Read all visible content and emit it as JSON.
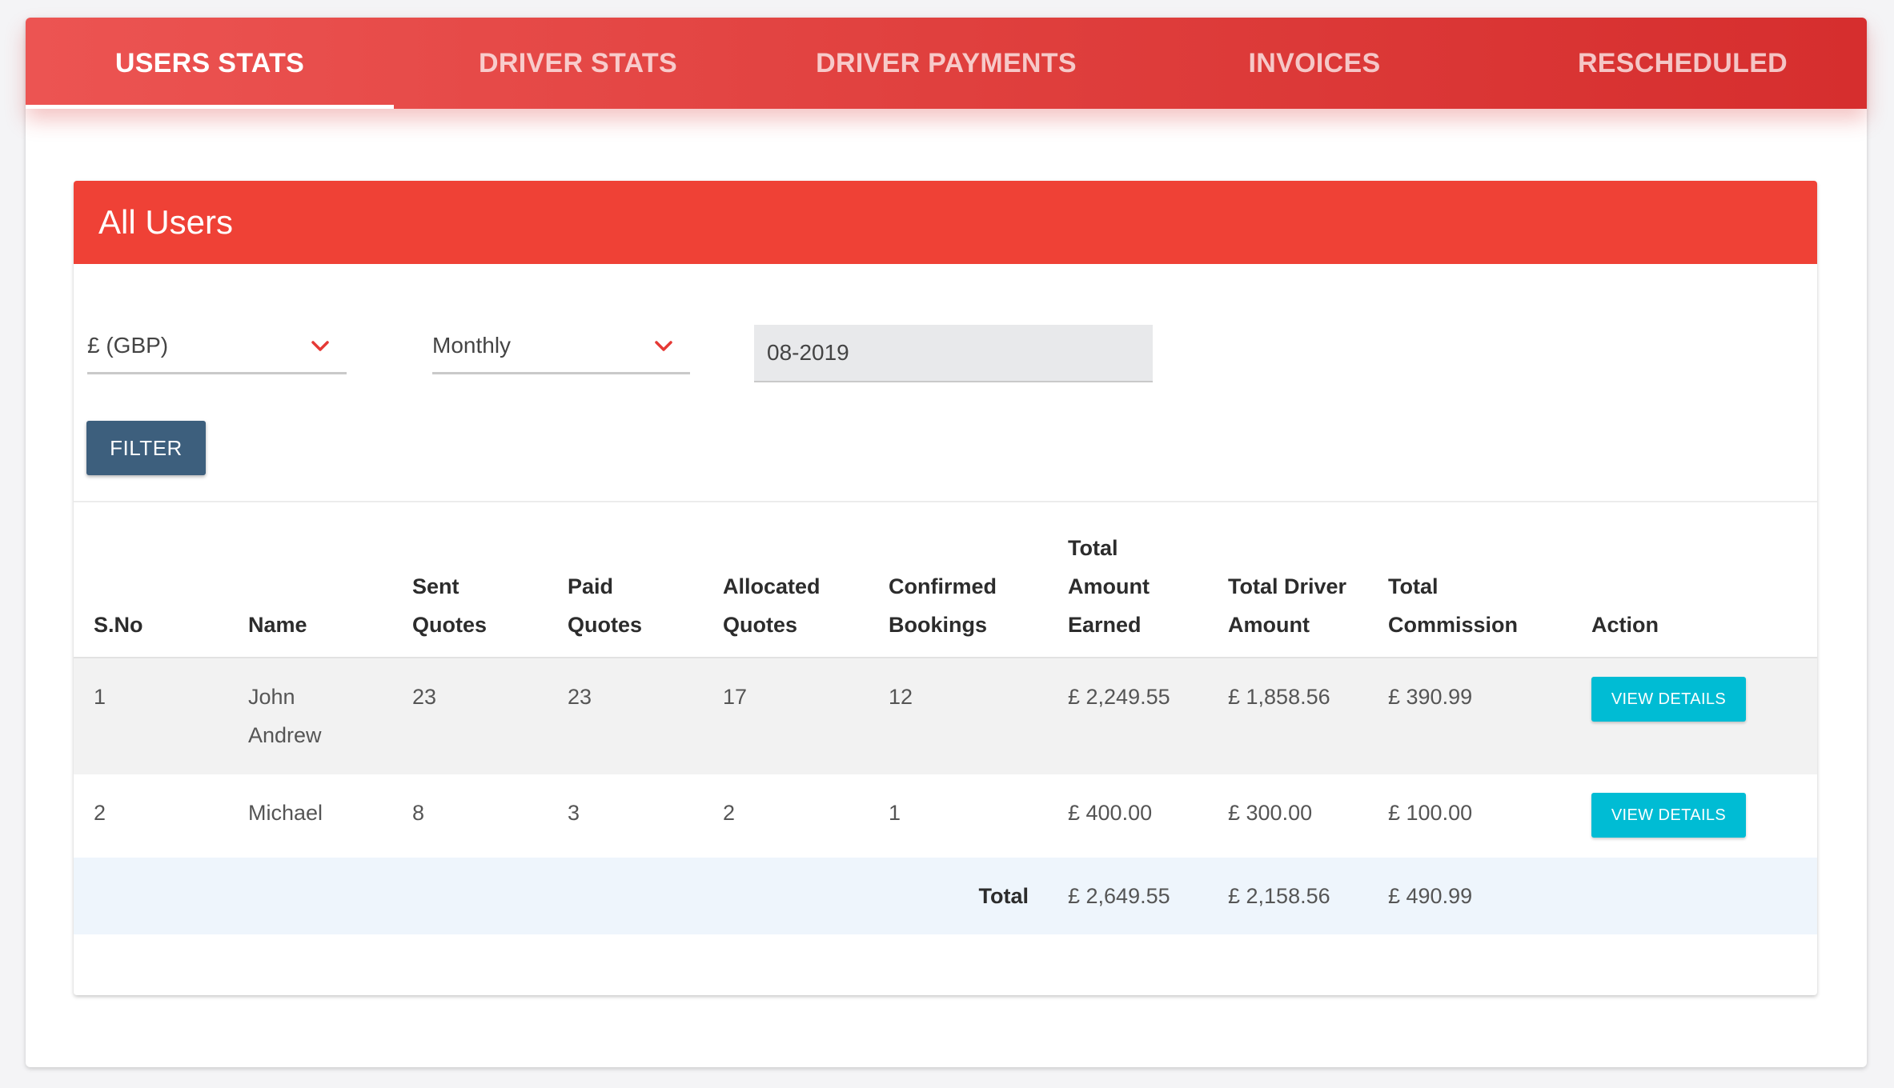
{
  "tabs": [
    {
      "label": "USERS STATS",
      "active": true
    },
    {
      "label": "DRIVER STATS",
      "active": false
    },
    {
      "label": "DRIVER PAYMENTS",
      "active": false
    },
    {
      "label": "INVOICES",
      "active": false
    },
    {
      "label": "RESCHEDULED",
      "active": false
    }
  ],
  "card": {
    "title": "All Users"
  },
  "filters": {
    "currency": "£ (GBP)",
    "period": "Monthly",
    "date": "08-2019",
    "filter_label": "FILTER"
  },
  "table": {
    "headers": {
      "sno": "S.No",
      "name": "Name",
      "sent_1": "Sent",
      "sent_2": "Quotes",
      "paid_1": "Paid",
      "paid_2": "Quotes",
      "alloc_1": "Allocated",
      "alloc_2": "Quotes",
      "conf_1": "Confirmed",
      "conf_2": "Bookings",
      "earned_1": "Total",
      "earned_2": "Amount",
      "earned_3": "Earned",
      "driver_1": "Total Driver",
      "driver_2": "Amount",
      "comm_1": "Total",
      "comm_2": "Commission",
      "action": "Action"
    },
    "rows": [
      {
        "sno": "1",
        "name_1": "John",
        "name_2": "Andrew",
        "sent": "23",
        "paid": "23",
        "allocated": "17",
        "confirmed": "12",
        "earned": "£ 2,249.55",
        "driver": "£ 1,858.56",
        "commission": "£ 390.99",
        "action": "VIEW DETAILS"
      },
      {
        "sno": "2",
        "name_1": "Michael",
        "name_2": "",
        "sent": "8",
        "paid": "3",
        "allocated": "2",
        "confirmed": "1",
        "earned": "£ 400.00",
        "driver": "£ 300.00",
        "commission": "£ 100.00",
        "action": "VIEW DETAILS"
      }
    ],
    "total": {
      "label": "Total",
      "earned": "£ 2,649.55",
      "driver": "£ 2,158.56",
      "commission": "£ 490.99"
    }
  },
  "colors": {
    "tab_bar": "#e0403e",
    "header": "#ef4136",
    "filter_button": "#3d5f7d",
    "view_button": "#00bcd4",
    "chevron": "#e53935",
    "total_row": "#eef5fc"
  },
  "icons": {
    "dropdown": "chevron-down-icon"
  }
}
